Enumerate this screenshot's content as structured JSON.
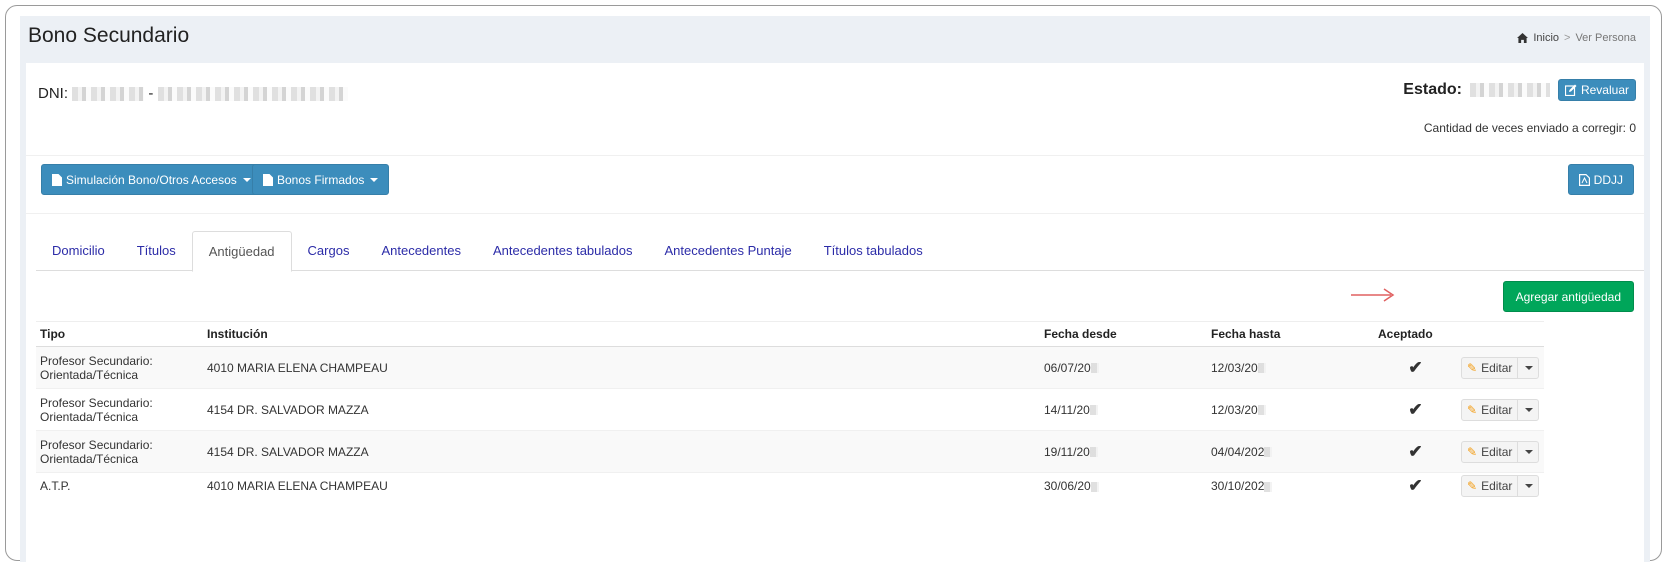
{
  "header": {
    "title": "Bono Secundario",
    "breadcrumb": {
      "home": "Inicio",
      "separator": ">",
      "current": "Ver Persona"
    }
  },
  "person": {
    "dni_label": "DNI:",
    "dni_separator": "-",
    "estado_label": "Estado:",
    "revaluar_label": "Revaluar",
    "cantidad_text": "Cantidad de veces enviado a corregir: 0"
  },
  "toolbar": {
    "simulacion_label": "Simulación Bono/Otros Accesos",
    "bonos_firmados_label": "Bonos Firmados",
    "ddjj_label": "DDJJ"
  },
  "tabs": [
    {
      "label": "Domicilio",
      "active": false
    },
    {
      "label": "Títulos",
      "active": false
    },
    {
      "label": "Antigüedad",
      "active": true
    },
    {
      "label": "Cargos",
      "active": false
    },
    {
      "label": "Antecedentes",
      "active": false
    },
    {
      "label": "Antecedentes tabulados",
      "active": false
    },
    {
      "label": "Antecedentes Puntaje",
      "active": false
    },
    {
      "label": "Títulos tabulados",
      "active": false
    }
  ],
  "agregar_label": "Agregar antigüedad",
  "table": {
    "columns": [
      "Tipo",
      "Institución",
      "Fecha desde",
      "Fecha hasta",
      "Aceptado"
    ],
    "edit_label": "Editar",
    "rows": [
      {
        "tipo_1": "Profesor Secundario:",
        "tipo_2": "Orientada/Técnica",
        "institucion": "4010 MARIA ELENA CHAMPEAU",
        "desde": "06/07/20",
        "hasta": "12/03/20",
        "aceptado": "✔"
      },
      {
        "tipo_1": "Profesor Secundario:",
        "tipo_2": "Orientada/Técnica",
        "institucion": "4154 DR. SALVADOR MAZZA",
        "desde": "14/11/20",
        "hasta": "12/03/20",
        "aceptado": "✔"
      },
      {
        "tipo_1": "Profesor Secundario:",
        "tipo_2": "Orientada/Técnica",
        "institucion": "4154 DR. SALVADOR MAZZA",
        "desde": "19/11/20",
        "hasta": "04/04/202",
        "aceptado": "✔"
      },
      {
        "tipo_1": "A.T.P.",
        "tipo_2": "",
        "institucion": "4010 MARIA ELENA CHAMPEAU",
        "desde": "30/06/20",
        "hasta": "30/10/202",
        "aceptado": "✔"
      }
    ]
  },
  "colors": {
    "primary": "#3c8dbc",
    "success": "#00a65a",
    "check": "#008d2f",
    "arrow": "#e06060"
  }
}
